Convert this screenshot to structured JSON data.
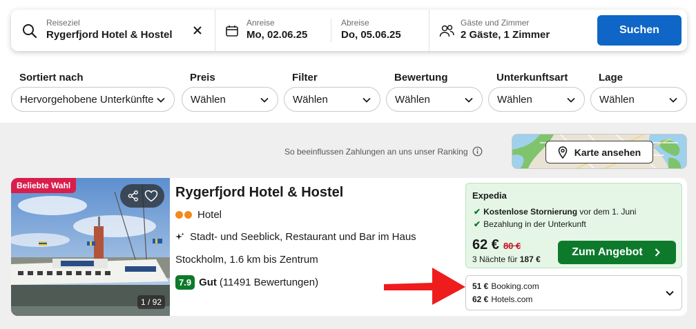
{
  "search": {
    "destination_label": "Reiseziel",
    "destination_value": "Rygerfjord Hotel & Hostel",
    "checkin_label": "Anreise",
    "checkin_value": "Mo, 02.06.25",
    "checkout_label": "Abreise",
    "checkout_value": "Do, 05.06.25",
    "guests_label": "Gäste und Zimmer",
    "guests_value": "2 Gäste, 1 Zimmer",
    "search_button": "Suchen"
  },
  "filters": [
    {
      "title": "Sortiert nach",
      "value": "Hervorgehobene Unterkünfte"
    },
    {
      "title": "Preis",
      "value": "Wählen"
    },
    {
      "title": "Filter",
      "value": "Wählen"
    },
    {
      "title": "Bewertung",
      "value": "Wählen"
    },
    {
      "title": "Unterkunftsart",
      "value": "Wählen"
    },
    {
      "title": "Lage",
      "value": "Wählen"
    }
  ],
  "ranking_note": "So beeinflussen Zahlungen an uns unser Ranking",
  "map_button": "Karte ansehen",
  "result": {
    "badge": "Beliebte Wahl",
    "photo_counter": "1 / 92",
    "name": "Rygerfjord Hotel & Hostel",
    "type": "Hotel",
    "features": "Stadt- und Seeblick, Restaurant und Bar im Haus",
    "location": "Stockholm, 1.6 km bis Zentrum",
    "score": "7.9",
    "rating_word": "Gut",
    "reviews": "(11491 Bewertungen)",
    "offer": {
      "provider": "Expedia",
      "perk1_bold": "Kostenlose Stornierung",
      "perk1_rest": "vor dem 1. Juni",
      "perk2": "Bezahlung in der Unterkunft",
      "price": "62 €",
      "old_price": "80 €",
      "nights_text": "3 Nächte für",
      "total": "187 €",
      "button": "Zum Angebot"
    },
    "alternatives": [
      {
        "price": "51 €",
        "provider": "Booking.com"
      },
      {
        "price": "62 €",
        "provider": "Hotels.com"
      }
    ]
  },
  "colors": {
    "primary_blue": "#0f66c6",
    "deal_green": "#0d7a2b",
    "badge_red": "#d91e4b",
    "annotation_arrow": "#ee1c1c"
  }
}
